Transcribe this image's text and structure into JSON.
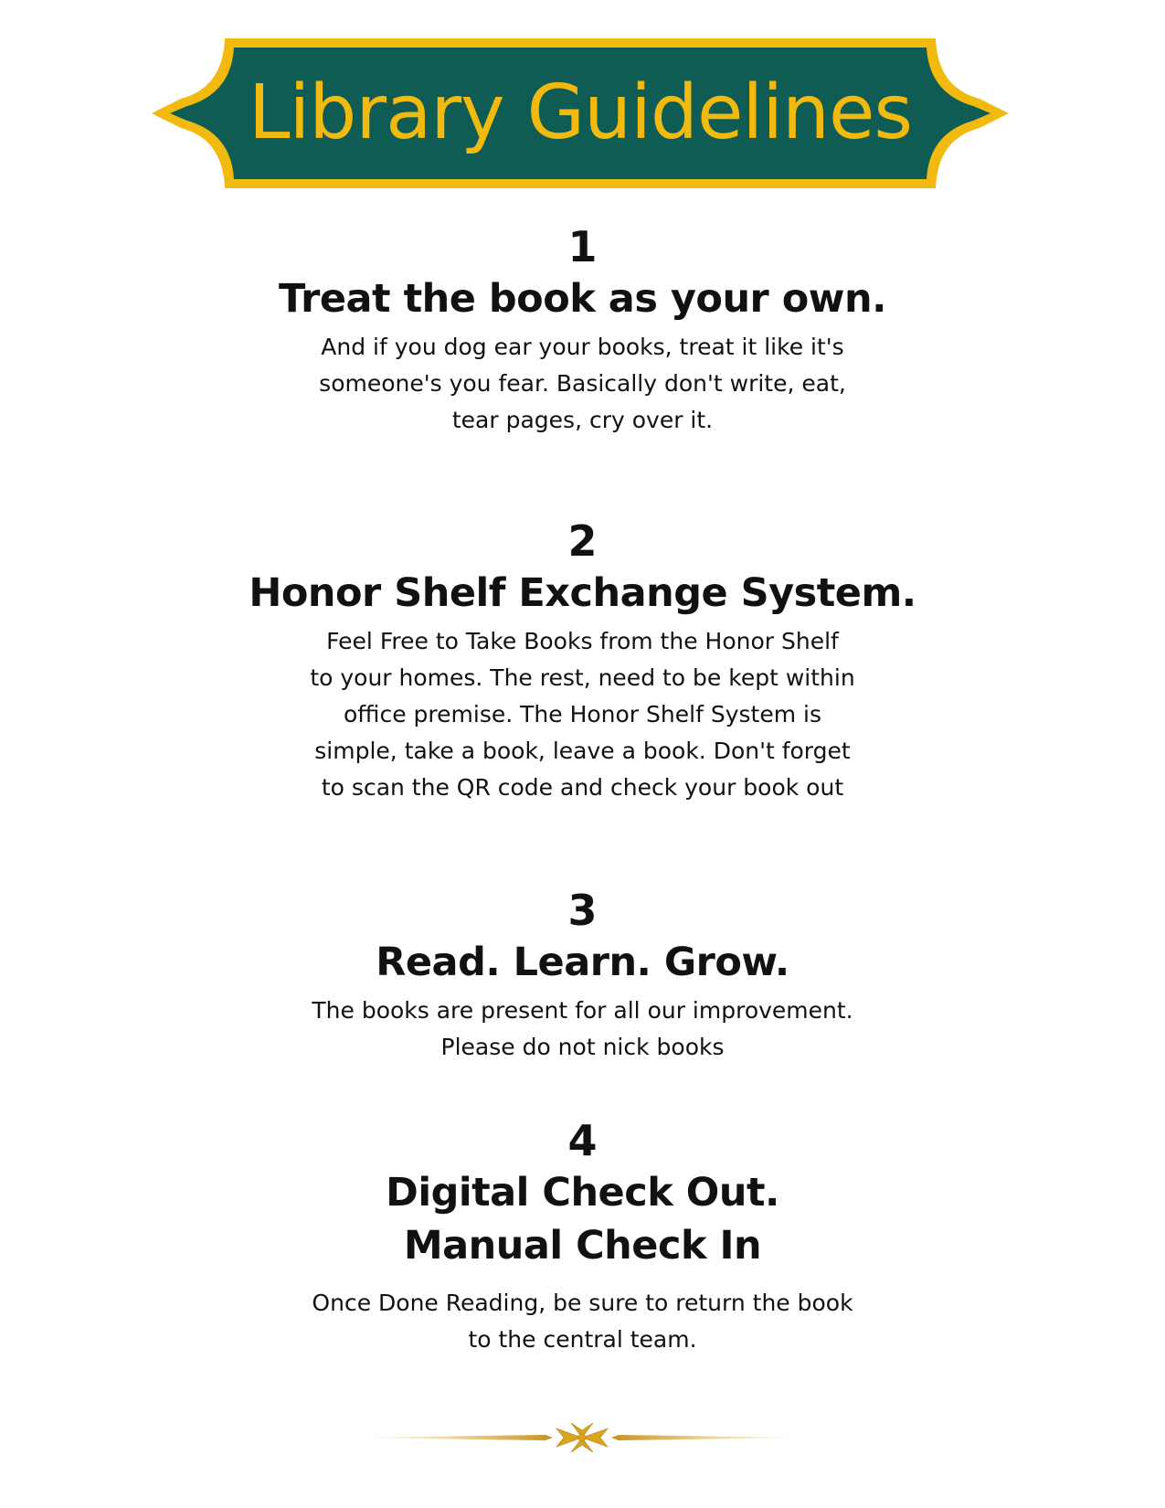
{
  "title": "Library Guidelines",
  "colors": {
    "banner_fill": "#0e5c53",
    "banner_border": "#f2b90f",
    "title_text": "#f2b90f",
    "ornament": "#d9a521"
  },
  "sections": [
    {
      "number": "1",
      "heading_lines": [
        "Treat the book as your own."
      ],
      "body_lines": [
        "And if you dog ear your books, treat it like it's",
        "someone's you fear. Basically don't write, eat,",
        "tear pages, cry over it."
      ]
    },
    {
      "number": "2",
      "heading_lines": [
        "Honor Shelf Exchange System."
      ],
      "body_lines": [
        "Feel Free to Take Books from the Honor Shelf",
        "to your homes. The rest, need to be kept within",
        "office premise. The Honor Shelf System is",
        "simple, take a book, leave a book. Don't forget",
        "to scan the QR code and check your book out"
      ]
    },
    {
      "number": "3",
      "heading_lines": [
        "Read. Learn. Grow."
      ],
      "body_lines": [
        "The books are present for all our improvement.",
        "Please do not nick books"
      ]
    },
    {
      "number": "4",
      "heading_lines": [
        "Digital Check Out.",
        "Manual Check In"
      ],
      "body_lines": [
        "Once Done Reading, be sure to return the book",
        "to the central team."
      ]
    }
  ]
}
